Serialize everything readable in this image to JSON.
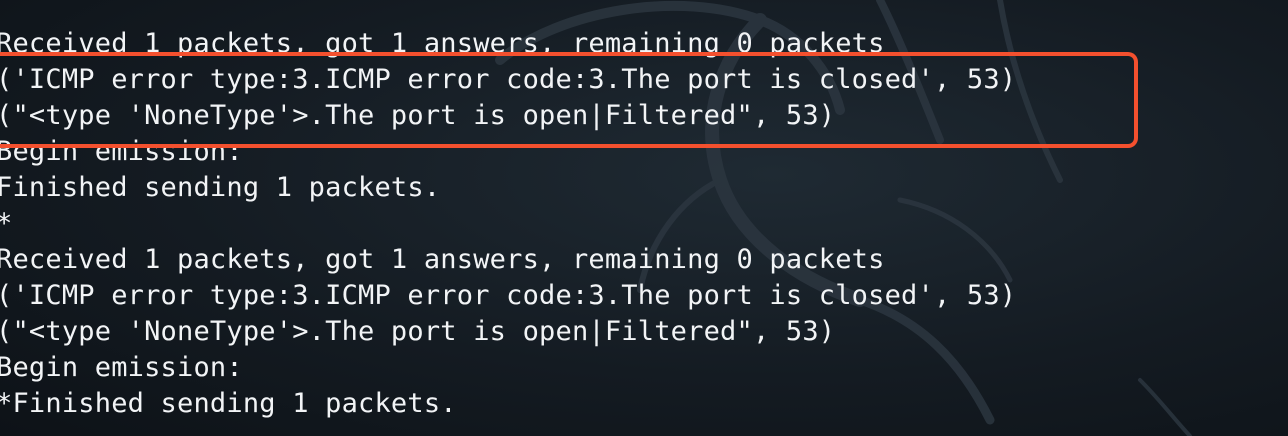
{
  "terminal": {
    "lines": [
      "Received 1 packets, got 1 answers, remaining 0 packets",
      "('ICMP error type:3.ICMP error code:3.The port is closed', 53)",
      "(\"<type 'NoneType'>.The port is open|Filtered\", 53)",
      "Begin emission:",
      "Finished sending 1 packets.",
      "*",
      "Received 1 packets, got 1 answers, remaining 0 packets",
      "('ICMP error type:3.ICMP error code:3.The port is closed', 53)",
      "(\"<type 'NoneType'>.The port is open|Filtered\", 53)",
      "Begin emission:",
      "*Finished sending 1 packets."
    ]
  },
  "colors": {
    "background": "#141b22",
    "text": "#f2f4f6",
    "highlight_border": "#f4502e",
    "watermark": "#2a343d"
  },
  "watermark": {
    "icon": "kali-dragon-icon"
  }
}
